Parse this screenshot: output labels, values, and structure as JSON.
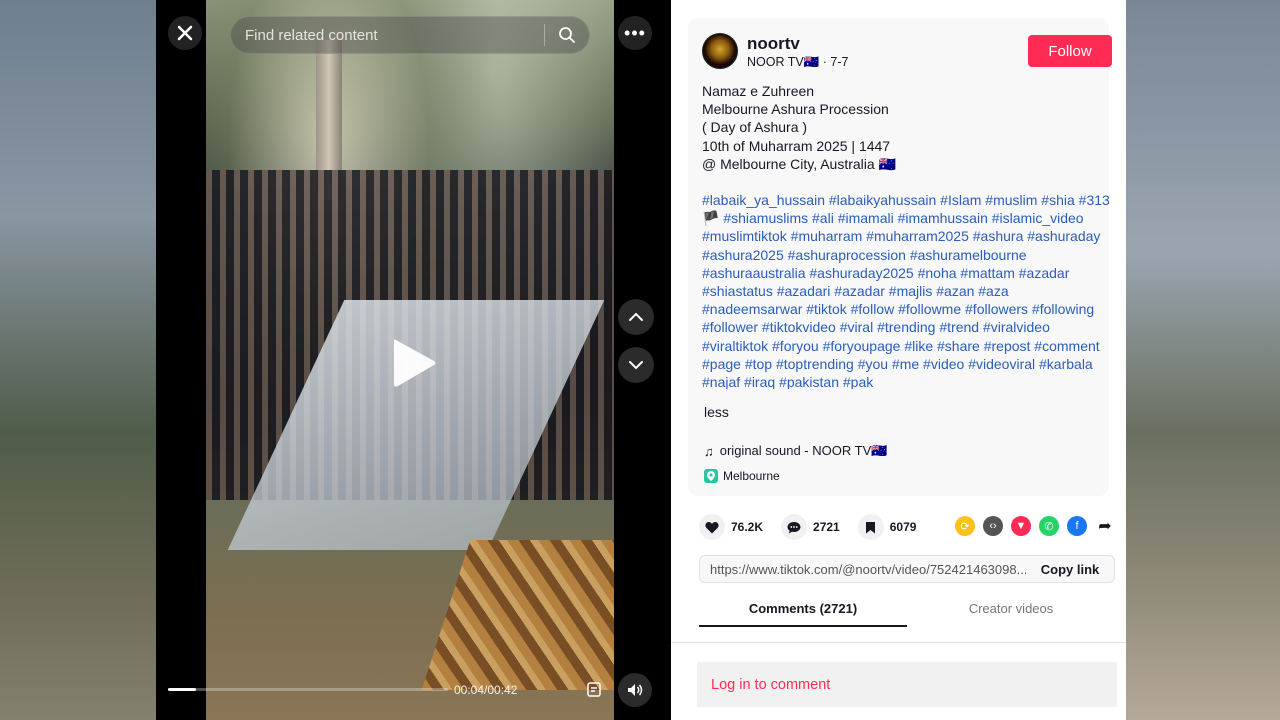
{
  "player": {
    "search_placeholder": "Find related content",
    "current_time": "00:04/00:42",
    "progress_fraction": 0.1
  },
  "icons": {
    "close": "close-icon",
    "search": "search-icon",
    "more": "more-icon",
    "play": "play-icon",
    "nav_up": "chevron-up-icon",
    "nav_down": "chevron-down-icon",
    "volume": "volume-icon",
    "captions": "captions-icon"
  },
  "author": {
    "username": "noortv",
    "display_line": "NOOR TV🇦🇺 · 7-7",
    "follow_label": "Follow"
  },
  "description": {
    "lines": [
      "Namaz e Zuhreen",
      "Melbourne Ashura Procession",
      "( Day of Ashura )",
      "10th of Muharram 2025 | 1447",
      "@ Melbourne City, Australia 🇦🇺"
    ],
    "hashtags": "#labaik_ya_hussain #labaikyahussain #Islam #muslim #shia #313🏴 #shiamuslims #ali #imamali #imamhussain #islamic_video #muslimtiktok #muharram #muharram2025 #ashura #ashuraday #ashura2025 #ashuraprocession #ashuramelbourne #ashuraaustralia #ashuraday2025 #noha #mattam #azadar #shiastatus #azadari #azadar #majlis #azan #aza #nadeemsarwar #tiktok #follow #followme #followers #following #follower #tiktokvideo #viral #trending #trend #viralvideo #viraltiktok #foryou #foryoupage #like #share #repost #comment #page #top #toptrending #you #me #video #videoviral #karbala #najaf #iraq #pakistan #pak",
    "less_label": "less",
    "sound": "original sound - NOOR TV🇦🇺",
    "location": "Melbourne"
  },
  "stats": {
    "likes": "76.2K",
    "comments": "2721",
    "saves": "6079"
  },
  "share": {
    "link": "https://www.tiktok.com/@noortv/video/752421463098...",
    "copy_label": "Copy link",
    "colors": [
      "#fcc21b",
      "#555555",
      "#fe2c55",
      "#25d366",
      "#1877f2",
      "#161823"
    ]
  },
  "tabs": {
    "comments": "Comments (2721)",
    "creator_videos": "Creator videos"
  },
  "login_prompt": "Log in to comment"
}
